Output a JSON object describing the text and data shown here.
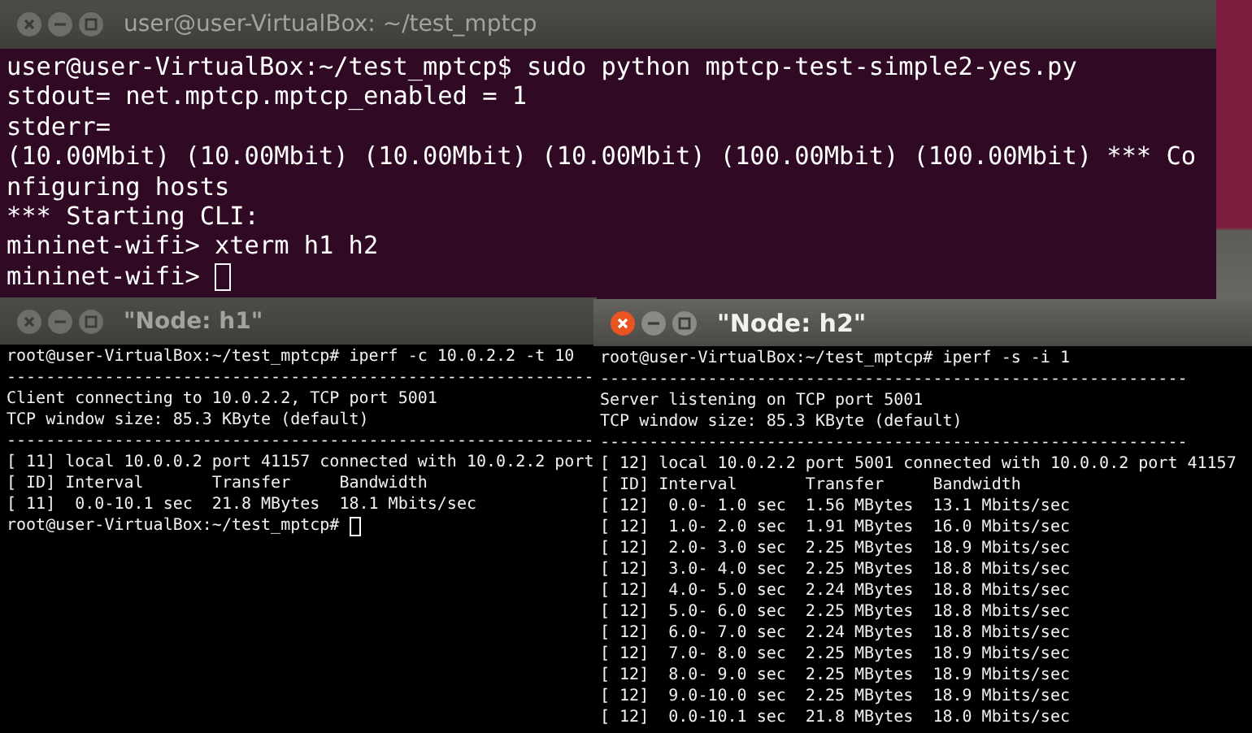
{
  "windows": [
    {
      "kind": "terminal",
      "title": "user@user-VirtualBox: ~/test_mptcp",
      "active": false,
      "cursor": true,
      "lines": [
        "user@user-VirtualBox:~/test_mptcp$ sudo python mptcp-test-simple2-yes.py",
        "stdout= net.mptcp.mptcp_enabled = 1",
        "stderr=",
        "(10.00Mbit) (10.00Mbit) (10.00Mbit) (10.00Mbit) (100.00Mbit) (100.00Mbit) *** Co",
        "nfiguring hosts",
        "*** Starting CLI:",
        "mininet-wifi> xterm h1 h2",
        "mininet-wifi> "
      ]
    },
    {
      "kind": "xterm",
      "title": "\"Node: h1\"",
      "active": false,
      "cursor": true,
      "lines": [
        "root@user-VirtualBox:~/test_mptcp# iperf -c 10.0.2.2 -t 10",
        "------------------------------------------------------------",
        "Client connecting to 10.0.2.2, TCP port 5001",
        "TCP window size: 85.3 KByte (default)",
        "------------------------------------------------------------",
        "[ 11] local 10.0.0.2 port 41157 connected with 10.0.2.2 port",
        "[ ID] Interval       Transfer     Bandwidth",
        "[ 11]  0.0-10.1 sec  21.8 MBytes  18.1 Mbits/sec",
        "root@user-VirtualBox:~/test_mptcp# "
      ]
    },
    {
      "kind": "xterm",
      "title": "\"Node: h2\"",
      "active": true,
      "cursor": false,
      "lines": [
        "root@user-VirtualBox:~/test_mptcp# iperf -s -i 1",
        "------------------------------------------------------------",
        "Server listening on TCP port 5001",
        "TCP window size: 85.3 KByte (default)",
        "------------------------------------------------------------",
        "[ 12] local 10.0.2.2 port 5001 connected with 10.0.0.2 port 41157",
        "[ ID] Interval       Transfer     Bandwidth",
        "[ 12]  0.0- 1.0 sec  1.56 MBytes  13.1 Mbits/sec",
        "[ 12]  1.0- 2.0 sec  1.91 MBytes  16.0 Mbits/sec",
        "[ 12]  2.0- 3.0 sec  2.25 MBytes  18.9 Mbits/sec",
        "[ 12]  3.0- 4.0 sec  2.25 MBytes  18.8 Mbits/sec",
        "[ 12]  4.0- 5.0 sec  2.24 MBytes  18.8 Mbits/sec",
        "[ 12]  5.0- 6.0 sec  2.25 MBytes  18.8 Mbits/sec",
        "[ 12]  6.0- 7.0 sec  2.24 MBytes  18.8 Mbits/sec",
        "[ 12]  7.0- 8.0 sec  2.25 MBytes  18.9 Mbits/sec",
        "[ 12]  8.0- 9.0 sec  2.25 MBytes  18.9 Mbits/sec",
        "[ 12]  9.0-10.0 sec  2.25 MBytes  18.9 Mbits/sec",
        "[ 12]  0.0-10.1 sec  21.8 MBytes  18.0 Mbits/sec"
      ]
    }
  ]
}
